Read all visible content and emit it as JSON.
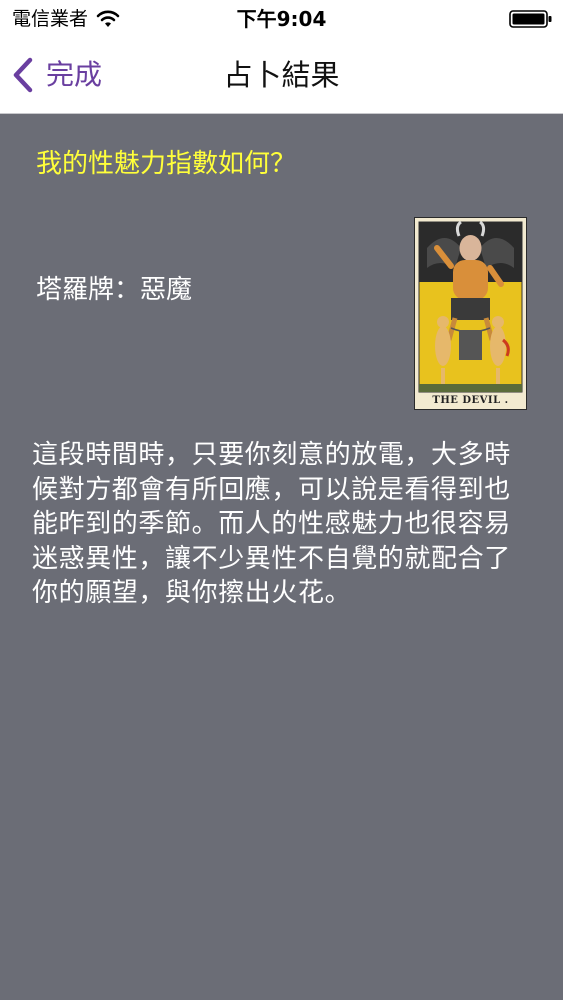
{
  "status_bar": {
    "carrier": "電信業者",
    "time": "下午9:04",
    "icons": [
      "wifi-icon",
      "battery-icon"
    ]
  },
  "nav": {
    "back_label": "完成",
    "title": "占卜結果",
    "back_icon": "chevron-left-icon"
  },
  "content": {
    "question": "我的性魅力指數如何？",
    "card_name": "塔羅牌：惡魔",
    "card_caption": "THE DEVIL .",
    "reading": "這段時間時，只要你刻意的放電，大多時候對方都會有所回應，可以說是看得到也能昨到的季節。而人的性感魅力也很容易迷惑異性，讓不少異性不自覺的就配合了你的願望，與你擦出火花。"
  },
  "colors": {
    "background": "#6b6d76",
    "accent": "#6a3fa0",
    "question_text": "#ffff3a",
    "body_text": "#ffffff"
  }
}
